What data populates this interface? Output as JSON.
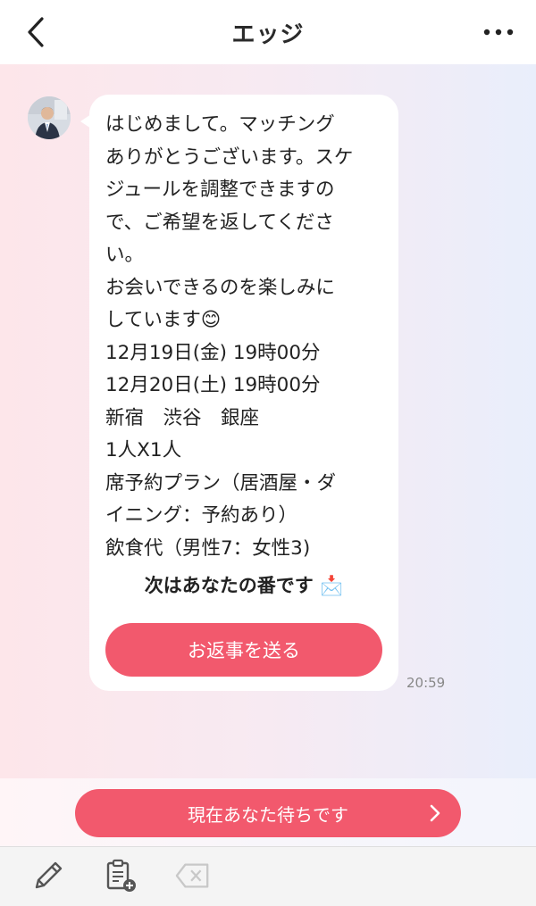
{
  "header": {
    "title": "エッジ"
  },
  "message": {
    "text": "はじめまして。マッチング\nありがとうございます。スケ\nジュールを調整できますの\nで、ご希望を返してくださ\nい。\nお会いできるのを楽しみに\nしています😊\n12月19日(金) 19時00分\n12月20日(土) 19時00分\n新宿　渋谷　銀座\n1人X1人\n席予約プラン（居酒屋・ダ\nイニング：予約あり）\n飲食代（男性7：女性3)",
    "turn_label": "次はあなたの番です",
    "turn_emoji": "📩",
    "reply_button": "お返事を送る",
    "time": "20:59"
  },
  "status_button": {
    "label": "現在あなた待ちです"
  },
  "colors": {
    "accent": "#f2596d"
  },
  "icons": {
    "back": "chevron-left-icon",
    "more": "more-horizontal-icon",
    "avatar": "avatar",
    "status_chevron": "chevron-right-icon",
    "toolbar": [
      "pencil-icon",
      "clipboard-add-icon",
      "backspace-icon"
    ]
  }
}
